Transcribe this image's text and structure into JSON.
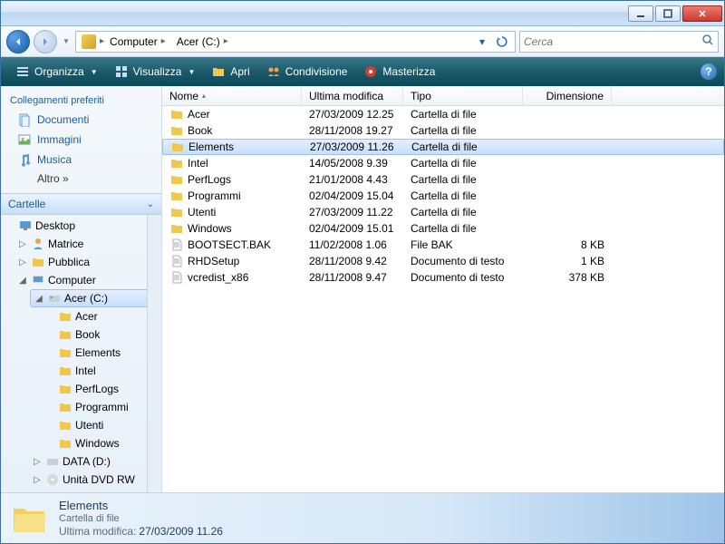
{
  "breadcrumb": {
    "seg1": "Computer",
    "seg2": "Acer (C:)"
  },
  "search": {
    "placeholder": "Cerca"
  },
  "toolbar": {
    "organize": "Organizza",
    "view": "Visualizza",
    "open": "Apri",
    "share": "Condivisione",
    "burn": "Masterizza"
  },
  "sidebar": {
    "favorites_header": "Collegamenti preferiti",
    "fav": {
      "docs": "Documenti",
      "pics": "Immagini",
      "music": "Musica",
      "more": "Altro »"
    },
    "folders_header": "Cartelle",
    "tree": {
      "desktop": "Desktop",
      "matrice": "Matrice",
      "pubblica": "Pubblica",
      "computer": "Computer",
      "acer": "Acer (C:)",
      "acer_f": "Acer",
      "book": "Book",
      "elements": "Elements",
      "intel": "Intel",
      "perflogs": "PerfLogs",
      "programmi": "Programmi",
      "utenti": "Utenti",
      "windows": "Windows",
      "data": "DATA (D:)",
      "dvd": "Unità DVD RW"
    }
  },
  "columns": {
    "name": "Nome",
    "modified": "Ultima modifica",
    "type": "Tipo",
    "size": "Dimensione"
  },
  "rows": [
    {
      "name": "Acer",
      "date": "27/03/2009 12.25",
      "type": "Cartella di file",
      "size": "",
      "icon": "folder"
    },
    {
      "name": "Book",
      "date": "28/11/2008 19.27",
      "type": "Cartella di file",
      "size": "",
      "icon": "folder"
    },
    {
      "name": "Elements",
      "date": "27/03/2009 11.26",
      "type": "Cartella di file",
      "size": "",
      "icon": "folder",
      "selected": true
    },
    {
      "name": "Intel",
      "date": "14/05/2008 9.39",
      "type": "Cartella di file",
      "size": "",
      "icon": "folder"
    },
    {
      "name": "PerfLogs",
      "date": "21/01/2008 4.43",
      "type": "Cartella di file",
      "size": "",
      "icon": "folder"
    },
    {
      "name": "Programmi",
      "date": "02/04/2009 15.04",
      "type": "Cartella di file",
      "size": "",
      "icon": "folder"
    },
    {
      "name": "Utenti",
      "date": "27/03/2009 11.22",
      "type": "Cartella di file",
      "size": "",
      "icon": "folder"
    },
    {
      "name": "Windows",
      "date": "02/04/2009 15.01",
      "type": "Cartella di file",
      "size": "",
      "icon": "folder"
    },
    {
      "name": "BOOTSECT.BAK",
      "date": "11/02/2008 1.06",
      "type": "File BAK",
      "size": "8 KB",
      "icon": "file"
    },
    {
      "name": "RHDSetup",
      "date": "28/11/2008 9.42",
      "type": "Documento di testo",
      "size": "1 KB",
      "icon": "file"
    },
    {
      "name": "vcredist_x86",
      "date": "28/11/2008 9.47",
      "type": "Documento di testo",
      "size": "378 KB",
      "icon": "file"
    }
  ],
  "details": {
    "name": "Elements",
    "type": "Cartella di file",
    "meta_label": "Ultima modifica:",
    "meta_value": "27/03/2009 11.26"
  }
}
